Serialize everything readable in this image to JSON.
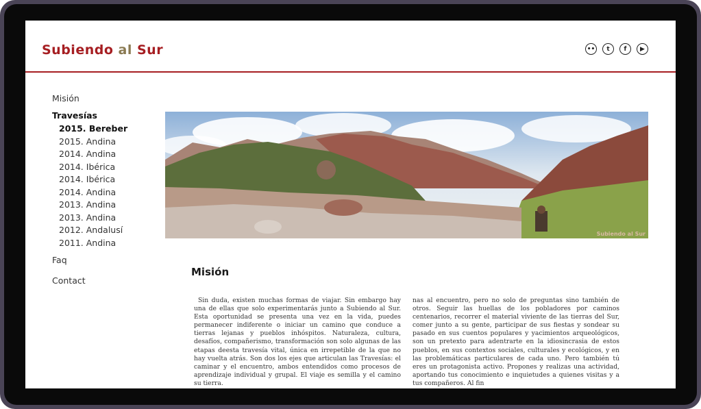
{
  "header": {
    "logo_part1": "Subiendo",
    "logo_part2": "al",
    "logo_part3": "Sur",
    "accent_color": "#a61e22",
    "social": [
      "flickr-icon",
      "twitter-icon",
      "facebook-icon",
      "youtube-icon"
    ]
  },
  "nav": {
    "mision": "Misión",
    "travesias": "Travesías",
    "sub_items": [
      "2015. Bereber",
      "2015. Andina",
      "2014. Andina",
      "2014. Ibérica",
      "2014. Ibérica",
      "2014. Andina",
      "2013. Andina",
      "2013. Andina",
      "2012. Andalusí",
      "2011. Andina"
    ],
    "faq": "Faq",
    "contact": "Contact"
  },
  "banner": {
    "watermark": "Subiendo al Sur"
  },
  "main": {
    "title": "Misión",
    "col1": "Sin duda, existen muchas formas de viajar. Sin embargo hay una de ellas que solo experimentarás junto a Subiendo al Sur. Esta oportunidad se presenta una vez en la vida, puedes permanecer indiferente o iniciar un camino que conduce a tierras lejanas y pueblos inhóspitos. Naturaleza, cultura, desafíos, compañerismo, transformación son solo algunas de las etapas deesta travesía vital, única en irrepetible de la que no hay vuelta atrás. Son dos los ejes que articulan las Travesías: el caminar y el encuentro, ambos entendidos como procesos de aprendizaje individual y grupal. El viaje es semilla y el camino su tierra.",
    "col2": "nas al encuentro, pero no solo de preguntas sino también de otros. Seguir las huellas de los pobladores por caminos centenarios, recorrer el material viviente de las tierras del Sur, comer junto a su gente, participar de sus fiestas y sondear su pasado en sus cuentos populares y yacimientos arqueológicos, son un pretexto para adentrarte en la idiosincrasia de estos pueblos, en sus contextos sociales, culturales y ecológicos, y en las problemáticas particulares de cada uno. Pero también tú eres un protagonista activo. Propones y realizas una actividad, aportando tus conocimiento e inquietudes a quienes visitas y a tus compañeros. Al fin"
  }
}
